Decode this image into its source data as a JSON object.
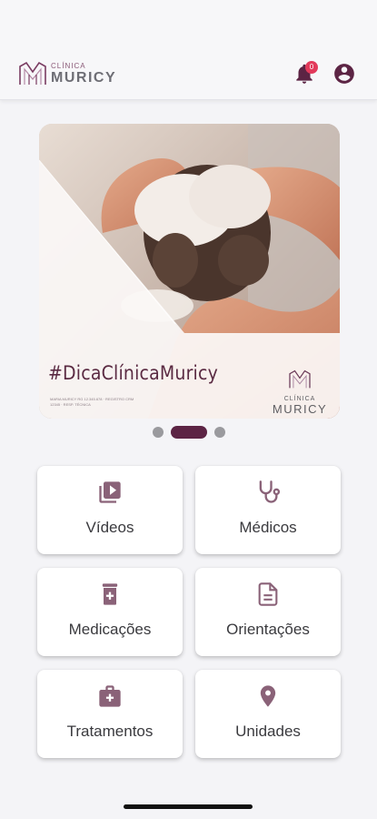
{
  "header": {
    "logo_small": "CLÍNICA",
    "logo_big": "MURICY",
    "notification_count": "0",
    "icons": {
      "notifications": "bell-icon",
      "account": "account-circle-icon"
    }
  },
  "banner": {
    "hashtag": "#DicaClínicaMuricy",
    "fine_print": "MARIA MURICY RG 12.345.678 · REGISTRO CRM 12345 · RESP. TÉCNICA",
    "logo_small": "CLÍNICA",
    "logo_big": "MURICY"
  },
  "carousel": {
    "pages": 3,
    "active_index": 1
  },
  "menu": [
    {
      "label": "Vídeos",
      "icon": "video-library-icon"
    },
    {
      "label": "Médicos",
      "icon": "stethoscope-icon"
    },
    {
      "label": "Medicações",
      "icon": "medication-icon"
    },
    {
      "label": "Orientações",
      "icon": "document-icon"
    },
    {
      "label": "Tratamentos",
      "icon": "medical-kit-icon"
    },
    {
      "label": "Unidades",
      "icon": "location-pin-icon"
    }
  ],
  "colors": {
    "brand": "#5c2444",
    "icon": "#8a6278",
    "badge": "#e23a5b"
  }
}
